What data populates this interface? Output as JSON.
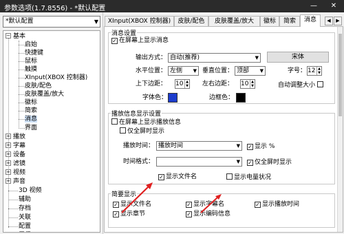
{
  "window": {
    "title": "参数选项(1.7.8556) - *默认配置",
    "minimize_icon": "—",
    "close_icon": "✕"
  },
  "sidebar": {
    "preset": "*默认配置",
    "tree": [
      {
        "label": "基本",
        "expander": "−"
      },
      {
        "label": "启始"
      },
      {
        "label": "快捷键"
      },
      {
        "label": "鼠标"
      },
      {
        "label": "触摸"
      },
      {
        "label": "XInput(XBOX 控制器)"
      },
      {
        "label": "皮肤/配色"
      },
      {
        "label": "皮肤覆盖/放大"
      },
      {
        "label": "徽标"
      },
      {
        "label": "简索"
      },
      {
        "label": "消息"
      },
      {
        "label": "界面"
      },
      {
        "label": "播放",
        "expander": "+"
      },
      {
        "label": "字幕",
        "expander": "+"
      },
      {
        "label": "设备",
        "expander": "+"
      },
      {
        "label": "滤镜",
        "expander": "+"
      },
      {
        "label": "视频",
        "expander": "+"
      },
      {
        "label": "声音",
        "expander": "+"
      },
      {
        "label": "3D 视频"
      },
      {
        "label": "辅助"
      },
      {
        "label": "存档"
      },
      {
        "label": "关联"
      },
      {
        "label": "配置"
      },
      {
        "label": "屏保"
      }
    ]
  },
  "tabs": [
    "XInput(XBOX 控制器)",
    "皮肤/配色",
    "皮肤覆盖/放大",
    "徽标",
    "简索",
    "消息"
  ],
  "tab_scroll": {
    "left": "◀",
    "right": "▶"
  },
  "message": {
    "group_title": "消息设置",
    "show_on_screen": "在屏幕上显示消息",
    "output_label": "输出方式：",
    "output_value": "自动(推荐)",
    "font_button": "宋体",
    "hpos_label": "水平位置：",
    "hpos_value": "左侧",
    "vpos_label": "垂直位置：",
    "vpos_value": "顶部",
    "size_label": "字号：",
    "size_value": "12",
    "tb_margin_label": "上下边距：",
    "tb_margin_value": "10",
    "lr_margin_label": "左右边距：",
    "lr_margin_value": "10",
    "auto_size": "自动调整大小",
    "font_color_label": "字体色：",
    "border_color_label": "边框色：",
    "font_color": "#1c3ccc",
    "border_color": "#000000"
  },
  "playback_info": {
    "group_title": "播放信息显示设置",
    "show_on_screen": "在屏幕上显示播放信息",
    "fullscreen_only": "仅全屏时显示",
    "time_label": "播放时间：",
    "time_value": "播放时间",
    "show_pct": "显示 %",
    "format_label": "时间格式：",
    "format_value": "",
    "fullscreen_only2": "仅全屏时显示",
    "show_filename": "显示文件名",
    "show_battery": "显示电量状况"
  },
  "brief": {
    "group_title": "简要显示",
    "items": [
      "显示文件名",
      "显示字幕名",
      "显示播放时间",
      "显示章节",
      "显示编码信息"
    ]
  },
  "check_mark": "✓",
  "arrow_down": "▼",
  "spin_up": "▲",
  "spin_down": "▼"
}
